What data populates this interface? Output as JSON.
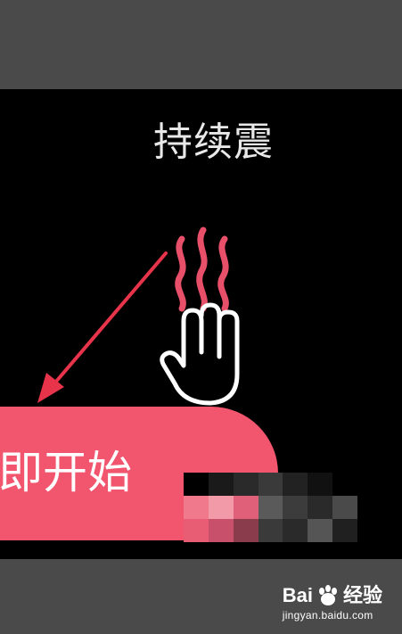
{
  "screen": {
    "mode_title": "持续震",
    "start_button_label": "即开始"
  },
  "watermark": {
    "brand_left": "Bai",
    "brand_right": "经验",
    "url": "jingyan.baidu.com"
  },
  "colors": {
    "accent": "#f2556e",
    "background": "#000000",
    "frame": "#4a4a4a",
    "wave": "#e8506a"
  },
  "icons": [
    "vibration-waves-icon",
    "hand-icon",
    "arrow-annotation",
    "baidu-paw-icon"
  ]
}
